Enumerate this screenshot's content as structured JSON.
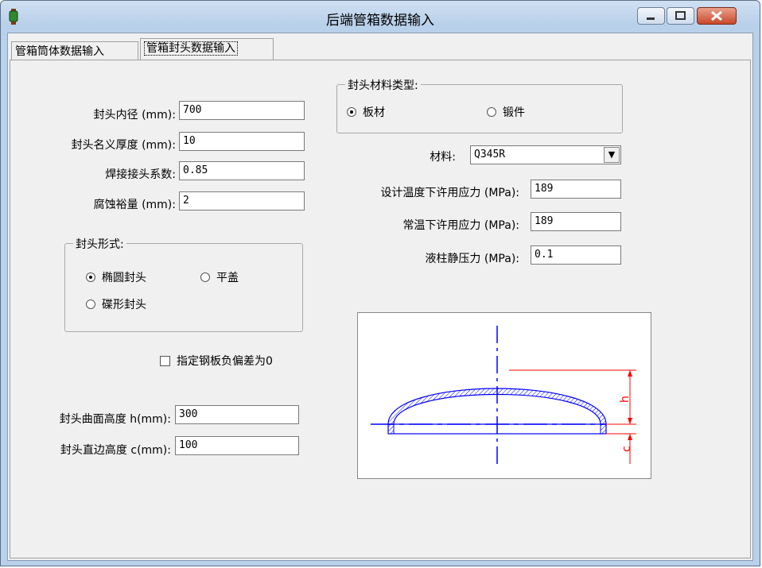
{
  "window": {
    "title": "后端管箱数据输入"
  },
  "tabs": [
    {
      "label": "管箱筒体数据输入"
    },
    {
      "label": "管箱封头数据输入"
    }
  ],
  "left": {
    "inner_diameter": {
      "label": "封头内径 (mm):",
      "value": "700"
    },
    "nominal_thickness": {
      "label": "封头名义厚度 (mm):",
      "value": "10"
    },
    "weld_coefficient": {
      "label": "焊接接头系数:",
      "value": "0.85"
    },
    "corrosion": {
      "label": "腐蚀裕量 (mm):",
      "value": "2"
    },
    "head_form": {
      "title": "封头形式:",
      "options": [
        "椭圆封头",
        "平盖",
        "碟形封头"
      ],
      "selected": "椭圆封头"
    },
    "negative_tolerance": {
      "label": "指定钢板负偏差为0"
    },
    "curve_height": {
      "label": "封头曲面高度 h(mm):",
      "value": "300"
    },
    "straight_height": {
      "label": "封头直边高度 c(mm):",
      "value": "100"
    }
  },
  "right": {
    "material_type": {
      "title": "封头材料类型:",
      "options": [
        "板材",
        "锻件"
      ],
      "selected": "板材"
    },
    "material": {
      "label": "材料:",
      "value": "Q345R"
    },
    "design_stress": {
      "label": "设计温度下许用应力 (MPa):",
      "value": "189"
    },
    "room_stress": {
      "label": "常温下许用应力 (MPa):",
      "value": "189"
    },
    "hydrostatic": {
      "label": "液柱静压力 (MPa):",
      "value": "0.1"
    },
    "diagram": {
      "labels": [
        "h",
        "c"
      ]
    }
  },
  "colors": {
    "diagram_blue": "#0000ff",
    "diagram_red": "#ff0000"
  }
}
